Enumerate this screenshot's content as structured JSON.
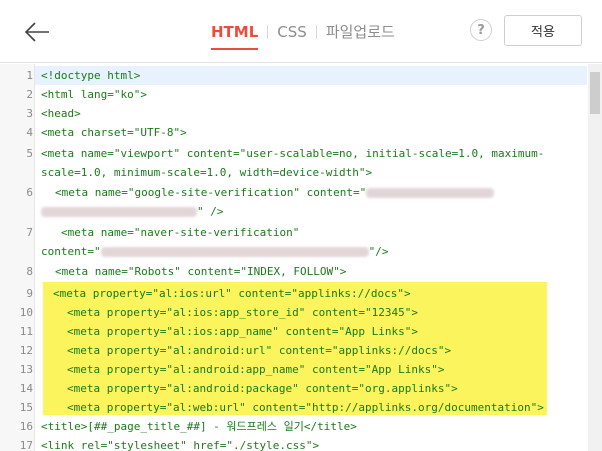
{
  "toolbar": {
    "back_icon": "arrow-left-icon",
    "tabs": [
      {
        "label": "HTML",
        "active": true
      },
      {
        "label": "CSS",
        "active": false
      },
      {
        "label": "파일업로드",
        "active": false
      }
    ],
    "help_label": "?",
    "apply_label": "적용",
    "accent_color": "#ef4b3d"
  },
  "editor": {
    "highlight_color": "#fbf45c",
    "line_numbers": [
      "1",
      "2",
      "3",
      "4",
      "5",
      "6",
      "7",
      "8",
      "9",
      "10",
      "11",
      "12",
      "13",
      "14",
      "15",
      "16",
      "17"
    ],
    "lines": {
      "l1": "<!doctype html>",
      "l2": "<html lang=\"ko\">",
      "l3": "<head>",
      "l4": "<meta charset=\"UTF-8\">",
      "l5a": "<meta name=\"viewport\" content=\"user-scalable=no, initial-scale=1.0, maximum-",
      "l5b": "scale=1.0, minimum-scale=1.0, width=device-width\">",
      "l6a": "<meta name=\"google-site-verification\" content=\"",
      "l6b": "\" />",
      "l7a": "<meta name=\"naver-site-verification\"",
      "l7b_pre": "content=\"",
      "l7b_post": "\"/>",
      "l8": "<meta name=\"Robots\" content=\"INDEX, FOLLOW\">",
      "l9": "<meta property=\"al:ios:url\" content=\"applinks://docs\">",
      "l10": "<meta property=\"al:ios:app_store_id\" content=\"12345\">",
      "l11": "<meta property=\"al:ios:app_name\" content=\"App Links\">",
      "l12": "<meta property=\"al:android:url\" content=\"applinks://docs\">",
      "l13": "<meta property=\"al:android:app_name\" content=\"App Links\">",
      "l14": "<meta property=\"al:android:package\" content=\"org.applinks\">",
      "l15": "<meta property=\"al:web:url\" content=\"http://applinks.org/documentation\">",
      "l16": "<title>[##_page_title_##] - 워드프레스 일기</title>",
      "l17": "<link rel=\"stylesheet\" href=\"./style.css\">"
    }
  }
}
